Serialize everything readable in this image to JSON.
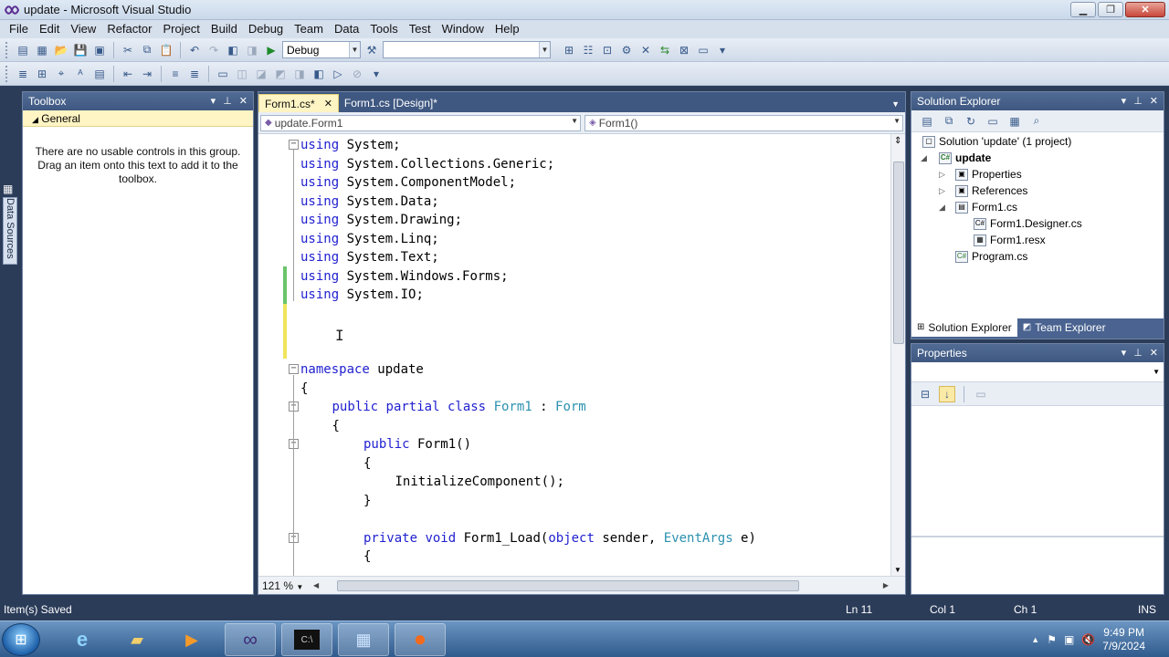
{
  "window": {
    "title": "update - Microsoft Visual Studio"
  },
  "menu": [
    "File",
    "Edit",
    "View",
    "Refactor",
    "Project",
    "Build",
    "Debug",
    "Team",
    "Data",
    "Tools",
    "Test",
    "Window",
    "Help"
  ],
  "toolbar": {
    "config": "Debug",
    "platform": ""
  },
  "side_tab": "Data Sources",
  "toolbox": {
    "title": "Toolbox",
    "group": "General",
    "empty_text": "There are no usable controls in this group. Drag an item onto this text to add it to the toolbox."
  },
  "editor": {
    "tabs": [
      "Form1.cs*",
      "Form1.cs [Design]*"
    ],
    "nav_left": "update.Form1",
    "nav_right": "Form1()",
    "zoom": "121 %",
    "lines": [
      {
        "indent": 0,
        "tokens": [
          {
            "t": "using",
            "c": "kw"
          },
          {
            "t": " System;"
          }
        ]
      },
      {
        "indent": 0,
        "tokens": [
          {
            "t": "using",
            "c": "kw"
          },
          {
            "t": " System.Collections.Generic;"
          }
        ]
      },
      {
        "indent": 0,
        "tokens": [
          {
            "t": "using",
            "c": "kw"
          },
          {
            "t": " System.ComponentModel;"
          }
        ]
      },
      {
        "indent": 0,
        "tokens": [
          {
            "t": "using",
            "c": "kw"
          },
          {
            "t": " System.Data;"
          }
        ]
      },
      {
        "indent": 0,
        "tokens": [
          {
            "t": "using",
            "c": "kw"
          },
          {
            "t": " System.Drawing;"
          }
        ]
      },
      {
        "indent": 0,
        "tokens": [
          {
            "t": "using",
            "c": "kw"
          },
          {
            "t": " System.Linq;"
          }
        ]
      },
      {
        "indent": 0,
        "tokens": [
          {
            "t": "using",
            "c": "kw"
          },
          {
            "t": " System.Text;"
          }
        ]
      },
      {
        "indent": 0,
        "tokens": [
          {
            "t": "using",
            "c": "kw"
          },
          {
            "t": " System.Windows.Forms;"
          }
        ]
      },
      {
        "indent": 0,
        "tokens": [
          {
            "t": "using",
            "c": "kw"
          },
          {
            "t": " System.IO;"
          }
        ]
      },
      {
        "indent": 0,
        "tokens": []
      },
      {
        "indent": 0,
        "tokens": []
      },
      {
        "indent": 0,
        "tokens": []
      },
      {
        "indent": 0,
        "tokens": [
          {
            "t": "namespace",
            "c": "kw"
          },
          {
            "t": " update"
          }
        ]
      },
      {
        "indent": 0,
        "tokens": [
          {
            "t": "{"
          }
        ]
      },
      {
        "indent": 1,
        "tokens": [
          {
            "t": "public",
            "c": "kw"
          },
          {
            "t": " "
          },
          {
            "t": "partial",
            "c": "kw"
          },
          {
            "t": " "
          },
          {
            "t": "class",
            "c": "kw"
          },
          {
            "t": " "
          },
          {
            "t": "Form1",
            "c": "ty"
          },
          {
            "t": " : "
          },
          {
            "t": "Form",
            "c": "ty"
          }
        ]
      },
      {
        "indent": 1,
        "tokens": [
          {
            "t": "{"
          }
        ]
      },
      {
        "indent": 2,
        "tokens": [
          {
            "t": "public",
            "c": "kw"
          },
          {
            "t": " Form1()"
          }
        ]
      },
      {
        "indent": 2,
        "tokens": [
          {
            "t": "{"
          }
        ]
      },
      {
        "indent": 3,
        "tokens": [
          {
            "t": "InitializeComponent();"
          }
        ]
      },
      {
        "indent": 2,
        "tokens": [
          {
            "t": "}"
          }
        ]
      },
      {
        "indent": 0,
        "tokens": []
      },
      {
        "indent": 2,
        "tokens": [
          {
            "t": "private",
            "c": "kw"
          },
          {
            "t": " "
          },
          {
            "t": "void",
            "c": "kw"
          },
          {
            "t": " Form1_Load("
          },
          {
            "t": "object",
            "c": "kw"
          },
          {
            "t": " sender, "
          },
          {
            "t": "EventArgs",
            "c": "ty"
          },
          {
            "t": " e)"
          }
        ]
      },
      {
        "indent": 2,
        "tokens": [
          {
            "t": "{"
          }
        ]
      }
    ]
  },
  "solution_explorer": {
    "title": "Solution Explorer",
    "nodes": [
      {
        "label": "Solution 'update' (1 project)",
        "icon": "solution-icon"
      },
      {
        "label": "update",
        "icon": "csharp-project-icon"
      },
      {
        "label": "Properties",
        "icon": "folder-icon"
      },
      {
        "label": "References",
        "icon": "folder-icon"
      },
      {
        "label": "Form1.cs",
        "icon": "form-icon"
      },
      {
        "label": "Form1.Designer.cs",
        "icon": "csharp-file-icon"
      },
      {
        "label": "Form1.resx",
        "icon": "resx-icon"
      },
      {
        "label": "Program.cs",
        "icon": "csharp-file-icon"
      }
    ],
    "tabs": [
      "Solution Explorer",
      "Team Explorer"
    ]
  },
  "properties": {
    "title": "Properties"
  },
  "status": {
    "message": "Item(s) Saved",
    "ln": "Ln 11",
    "col": "Col 1",
    "ch": "Ch 1",
    "mode": "INS"
  },
  "taskbar": {
    "time": "9:49 PM",
    "date": "7/9/2024"
  }
}
